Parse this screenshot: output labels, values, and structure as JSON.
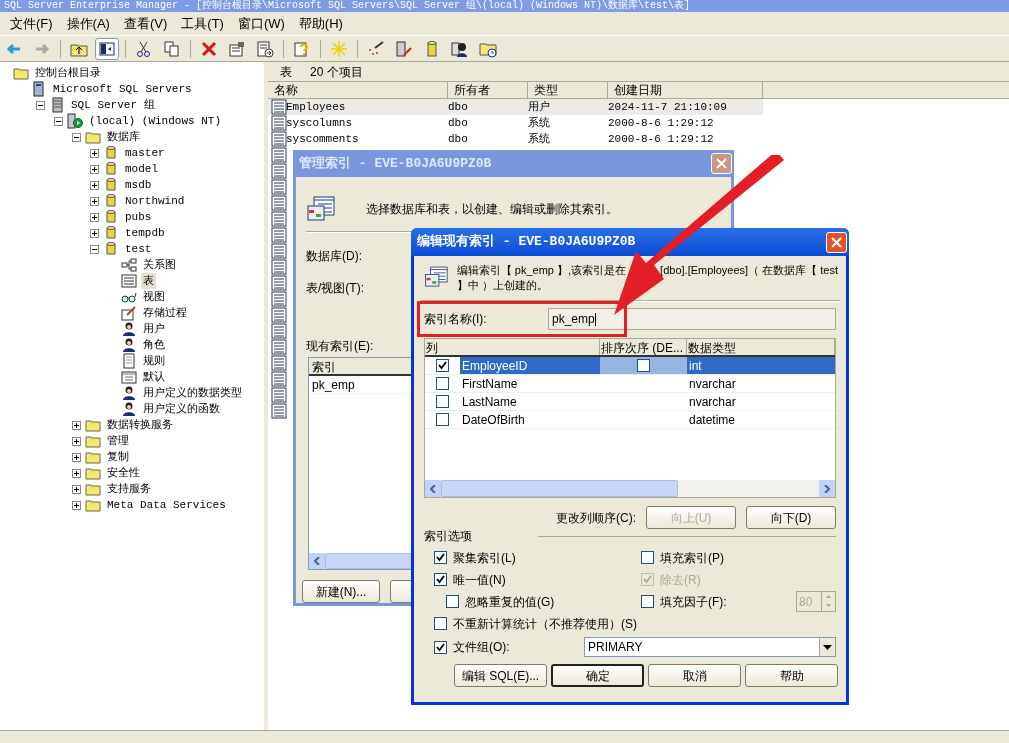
{
  "window": {
    "title": "SQL Server Enterprise Manager - [控制台根目录\\Microsoft SQL Servers\\SQL Server 组\\(local) (Windows NT)\\数据库\\test\\表]"
  },
  "menu": [
    "文件(F)",
    "操作(A)",
    "查看(V)",
    "工具(T)",
    "窗口(W)",
    "帮助(H)"
  ],
  "toolbar": [
    {
      "kind": "back",
      "pressed": false
    },
    {
      "kind": "forward",
      "pressed": false
    },
    {
      "kind": "sep"
    },
    {
      "kind": "up",
      "pressed": false
    },
    {
      "kind": "tree",
      "pressed": true
    },
    {
      "kind": "sep"
    },
    {
      "kind": "cut",
      "pressed": false
    },
    {
      "kind": "copy",
      "pressed": false
    },
    {
      "kind": "sep"
    },
    {
      "kind": "delete",
      "pressed": false
    },
    {
      "kind": "properties",
      "pressed": false
    },
    {
      "kind": "export",
      "pressed": false
    },
    {
      "kind": "sep"
    },
    {
      "kind": "help",
      "pressed": false
    },
    {
      "kind": "sep"
    },
    {
      "kind": "new",
      "pressed": false
    },
    {
      "kind": "sep"
    },
    {
      "kind": "wizard",
      "pressed": false
    },
    {
      "kind": "edit",
      "pressed": false
    },
    {
      "kind": "database",
      "pressed": false
    },
    {
      "kind": "user",
      "pressed": false
    },
    {
      "kind": "schedule",
      "pressed": false
    }
  ],
  "tree": [
    {
      "label": "控制台根目录",
      "kind": "console",
      "selected": false,
      "children": [
        {
          "label": "Microsoft SQL Servers",
          "kind": "servers",
          "selected": false,
          "children": [
            {
              "label": "SQL Server 组",
              "kind": "group",
              "expanded": true,
              "selected": false,
              "children": [
                {
                  "label": "(local) (Windows NT)",
                  "kind": "server",
                  "expanded": true,
                  "selected": false,
                  "children": [
                    {
                      "label": "数据库",
                      "kind": "folder",
                      "expanded": true,
                      "selected": false,
                      "children": [
                        {
                          "label": "master",
                          "kind": "database",
                          "expanded": false,
                          "selected": false
                        },
                        {
                          "label": "model",
                          "kind": "database",
                          "expanded": false,
                          "selected": false
                        },
                        {
                          "label": "msdb",
                          "kind": "database",
                          "expanded": false,
                          "selected": false
                        },
                        {
                          "label": "Northwind",
                          "kind": "database",
                          "expanded": false,
                          "selected": false
                        },
                        {
                          "label": "pubs",
                          "kind": "database",
                          "expanded": false,
                          "selected": false
                        },
                        {
                          "label": "tempdb",
                          "kind": "database",
                          "expanded": false,
                          "selected": false
                        },
                        {
                          "label": "test",
                          "kind": "database",
                          "expanded": true,
                          "selected": false,
                          "children": [
                            {
                              "label": "关系图",
                              "kind": "diagram",
                              "selected": false
                            },
                            {
                              "label": "表",
                              "kind": "table",
                              "selected": true
                            },
                            {
                              "label": "视图",
                              "kind": "view",
                              "selected": false
                            },
                            {
                              "label": "存储过程",
                              "kind": "proc",
                              "selected": false
                            },
                            {
                              "label": "用户",
                              "kind": "user",
                              "selected": false
                            },
                            {
                              "label": "角色",
                              "kind": "role",
                              "selected": false
                            },
                            {
                              "label": "规则",
                              "kind": "rule",
                              "selected": false
                            },
                            {
                              "label": "默认",
                              "kind": "default",
                              "selected": false
                            },
                            {
                              "label": "用户定义的数据类型",
                              "kind": "udt",
                              "selected": false
                            },
                            {
                              "label": "用户定义的函数",
                              "kind": "func",
                              "selected": false
                            }
                          ]
                        }
                      ]
                    },
                    {
                      "label": "数据转换服务",
                      "kind": "folder",
                      "expanded": false,
                      "selected": false
                    },
                    {
                      "label": "管理",
                      "kind": "folder",
                      "expanded": false,
                      "selected": false
                    },
                    {
                      "label": "复制",
                      "kind": "folder",
                      "expanded": false,
                      "selected": false
                    },
                    {
                      "label": "安全性",
                      "kind": "folder",
                      "expanded": false,
                      "selected": false
                    },
                    {
                      "label": "支持服务",
                      "kind": "folder",
                      "expanded": false,
                      "selected": false
                    },
                    {
                      "label": "Meta Data Services",
                      "kind": "folder",
                      "expanded": false,
                      "selected": false
                    }
                  ]
                }
              ]
            }
          ]
        }
      ]
    }
  ],
  "list": {
    "title": "表",
    "count": "20 个项目",
    "columns": [
      "名称",
      "所有者",
      "类型",
      "创建日期"
    ],
    "rows": [
      {
        "kind": "row",
        "selected": true,
        "cells": [
          "Employees",
          "dbo",
          "用户",
          "2024-11-7 21:10:09"
        ]
      },
      {
        "kind": "row",
        "selected": false,
        "cells": [
          "syscolumns",
          "dbo",
          "系统",
          "2000-8-6 1:29:12"
        ]
      },
      {
        "kind": "row",
        "selected": false,
        "cells": [
          "syscomments",
          "dbo",
          "系统",
          "2000-8-6 1:29:12"
        ]
      },
      {
        "kind": "covered"
      },
      {
        "kind": "covered"
      },
      {
        "kind": "covered"
      },
      {
        "kind": "covered"
      },
      {
        "kind": "covered"
      },
      {
        "kind": "covered"
      },
      {
        "kind": "covered"
      },
      {
        "kind": "covered"
      },
      {
        "kind": "covered"
      },
      {
        "kind": "covered"
      },
      {
        "kind": "covered"
      },
      {
        "kind": "covered"
      },
      {
        "kind": "covered"
      },
      {
        "kind": "covered"
      },
      {
        "kind": "covered"
      },
      {
        "kind": "covered"
      },
      {
        "kind": "covered"
      }
    ]
  },
  "manage_dialog": {
    "title": "管理索引 - EVE-B0JA6U9PZ0B",
    "description": "选择数据库和表，以创建、编辑或删除其索引。",
    "database_label": "数据库(D):",
    "table_label": "表/视图(T):",
    "indexes_label": "现有索引(E):",
    "indexes_column": "索引",
    "indexes": [
      "pk_emp"
    ],
    "buttons": [
      "新建(N)..."
    ]
  },
  "edit_dialog": {
    "title": "编辑现有索引 - EVE-B0JA6U9PZ0B",
    "description": [
      "编辑索引【 pk_emp 】,该索引是在",
      "[dbo].[Employees]（ 在数据库【 test",
      "】中 ）上创建的。"
    ],
    "name_label": "索引名称(I):",
    "name_value": "pk_emp",
    "columns": [
      "列",
      "排序次序 (DE...",
      "数据类型"
    ],
    "rows": [
      {
        "name": "EmployeeID",
        "checked": true,
        "selected": true,
        "descending": false,
        "type": "int"
      },
      {
        "name": "FirstName",
        "checked": false,
        "selected": false,
        "type": "nvarchar"
      },
      {
        "name": "LastName",
        "checked": false,
        "selected": false,
        "type": "nvarchar"
      },
      {
        "name": "DateOfBirth",
        "checked": false,
        "selected": false,
        "type": "datetime"
      }
    ],
    "reorder_label": "更改列顺序(C):",
    "reorder_buttons": [
      {
        "label": "向上(U)",
        "disabled": true
      },
      {
        "label": "向下(D)",
        "disabled": false
      }
    ],
    "options_title": "索引选项",
    "options": [
      {
        "label": "聚集索引(L)",
        "checked": true,
        "disabled": false,
        "indent": false
      },
      {
        "label": "填充索引(P)",
        "checked": false,
        "disabled": false,
        "indent": false
      },
      {
        "label": "唯一值(N)",
        "checked": true,
        "disabled": false,
        "indent": false
      },
      {
        "label": "除去(R)",
        "checked": true,
        "disabled": true,
        "indent": false
      },
      {
        "label": "忽略重复的值(G)",
        "checked": false,
        "disabled": false,
        "indent": true
      },
      {
        "label": "填充因子(F):",
        "checked": false,
        "disabled": false,
        "indent": false,
        "spinner": "80"
      }
    ],
    "stats_option": {
      "label": "不重新计算统计（不推荐使用）(S)",
      "checked": false
    },
    "filegroup": {
      "label": "文件组(O):",
      "checked": true,
      "value": "PRIMARY"
    },
    "buttons": [
      {
        "label": "编辑 SQL(E)...",
        "default": false
      },
      {
        "label": "确定",
        "default": true
      },
      {
        "label": "取消",
        "default": false
      },
      {
        "label": "帮助",
        "default": false
      }
    ]
  }
}
